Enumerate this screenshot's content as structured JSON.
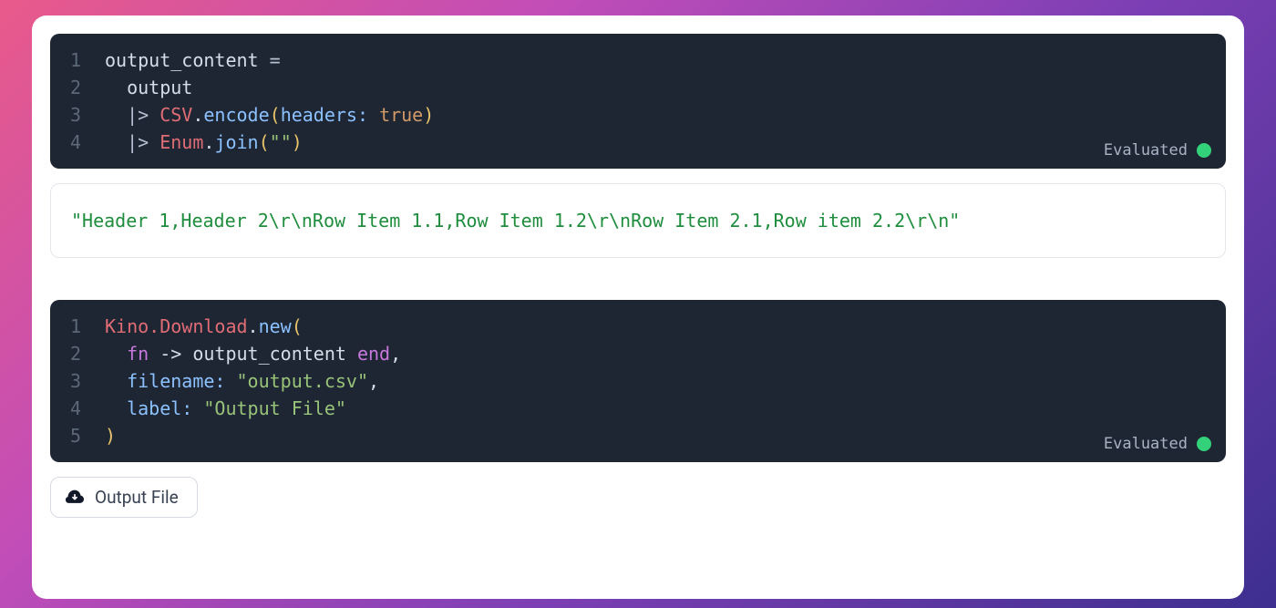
{
  "cells": {
    "cell1": {
      "lines": [
        [
          {
            "t": "output_content ",
            "c": "t-plain"
          },
          {
            "t": "=",
            "c": "t-op"
          }
        ],
        [
          {
            "t": "  output",
            "c": "t-plain"
          }
        ],
        [
          {
            "t": "  ",
            "c": "t-plain"
          },
          {
            "t": "|> ",
            "c": "t-op"
          },
          {
            "t": "CSV",
            "c": "t-module"
          },
          {
            "t": ".",
            "c": "t-plain"
          },
          {
            "t": "encode",
            "c": "t-func"
          },
          {
            "t": "(",
            "c": "t-yellow"
          },
          {
            "t": "headers: ",
            "c": "t-key"
          },
          {
            "t": "true",
            "c": "t-true"
          },
          {
            "t": ")",
            "c": "t-yellow"
          }
        ],
        [
          {
            "t": "  ",
            "c": "t-plain"
          },
          {
            "t": "|> ",
            "c": "t-op"
          },
          {
            "t": "Enum",
            "c": "t-module"
          },
          {
            "t": ".",
            "c": "t-plain"
          },
          {
            "t": "join",
            "c": "t-func"
          },
          {
            "t": "(",
            "c": "t-yellow"
          },
          {
            "t": "\"\"",
            "c": "t-str"
          },
          {
            "t": ")",
            "c": "t-yellow"
          }
        ]
      ],
      "status": "Evaluated"
    },
    "cell2": {
      "lines": [
        [
          {
            "t": "Kino.Download",
            "c": "t-module"
          },
          {
            "t": ".",
            "c": "t-plain"
          },
          {
            "t": "new",
            "c": "t-func"
          },
          {
            "t": "(",
            "c": "t-yellow"
          }
        ],
        [
          {
            "t": "  ",
            "c": "t-plain"
          },
          {
            "t": "fn",
            "c": "t-purple"
          },
          {
            "t": " -> output_content ",
            "c": "t-plain"
          },
          {
            "t": "end",
            "c": "t-purple"
          },
          {
            "t": ",",
            "c": "t-plain"
          }
        ],
        [
          {
            "t": "  ",
            "c": "t-plain"
          },
          {
            "t": "filename: ",
            "c": "t-key"
          },
          {
            "t": "\"output.csv\"",
            "c": "t-str"
          },
          {
            "t": ",",
            "c": "t-plain"
          }
        ],
        [
          {
            "t": "  ",
            "c": "t-plain"
          },
          {
            "t": "label: ",
            "c": "t-key"
          },
          {
            "t": "\"Output File\"",
            "c": "t-str"
          }
        ],
        [
          {
            "t": ")",
            "c": "t-yellow"
          }
        ]
      ],
      "status": "Evaluated"
    }
  },
  "output1": "\"Header 1,Header 2\\r\\nRow Item 1.1,Row Item 1.2\\r\\nRow Item 2.1,Row item 2.2\\r\\n\"",
  "download_label": "Output File"
}
